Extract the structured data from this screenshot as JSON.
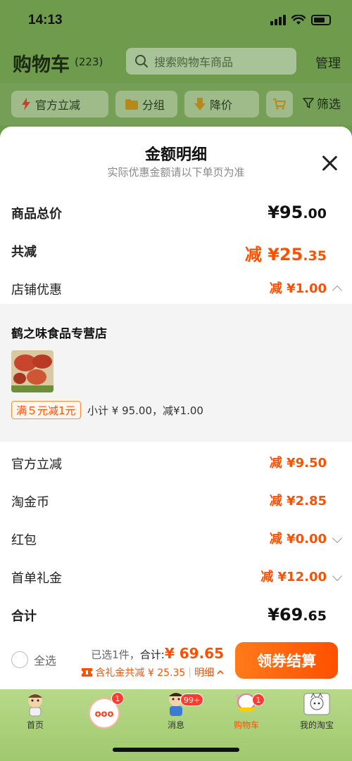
{
  "status_bar": {
    "time": "14:13"
  },
  "header": {
    "title": "购物车",
    "count": "(223)",
    "search_placeholder": "搜索购物车商品",
    "manage_label": "管理"
  },
  "filters": {
    "chips": [
      "官方立减",
      "分组",
      "降价"
    ],
    "filter_label": "筛选"
  },
  "sheet": {
    "title": "金额明细",
    "subtitle": "实际优惠金额请以下单页为准",
    "total_price": {
      "label": "商品总价",
      "value_main": "¥95",
      "value_dec": ".00"
    },
    "total_reduce": {
      "label": "共减",
      "value_main": "减 ¥25",
      "value_dec": ".35"
    },
    "shop_discount": {
      "label": "店铺优惠",
      "value_main": "减 ¥1",
      "value_dec": ".00"
    },
    "shop": {
      "name": "鹤之味食品专营店",
      "promo_tag": "满５元减1元",
      "subtotal": "小计 ¥ 95.00，减¥1.00"
    },
    "official_reduce": {
      "label": "官方立减",
      "value_main": "减 ¥9",
      "value_dec": ".50"
    },
    "taojinbi": {
      "label": "淘金币",
      "value_main": "减 ¥2",
      "value_dec": ".85"
    },
    "hongbao": {
      "label": "红包",
      "value_main": "减 ¥0",
      "value_dec": ".00"
    },
    "first_order_gift": {
      "label": "首单礼金",
      "value_main": "减 ¥12",
      "value_dec": ".00"
    },
    "grand_total": {
      "label": "合计",
      "value_main": "¥69",
      "value_dec": ".65"
    }
  },
  "checkout": {
    "select_all": "全选",
    "selected_text": "已选1件，",
    "total_label": "合计:",
    "total_amount": "¥ 69.65",
    "gift_text": "含礼金共减 ¥ 25.35",
    "detail_label": "明细",
    "button_label": "领券结算"
  },
  "tab_bar": {
    "tabs": [
      {
        "label": "首页",
        "badge": ""
      },
      {
        "label": "",
        "badge": "1"
      },
      {
        "label": "消息",
        "badge": "99+"
      },
      {
        "label": "购物车",
        "badge": "1"
      },
      {
        "label": "我的淘宝",
        "badge": ""
      }
    ]
  },
  "colors": {
    "accent": "#ff5000",
    "header_bg": "#6e9c4c"
  }
}
